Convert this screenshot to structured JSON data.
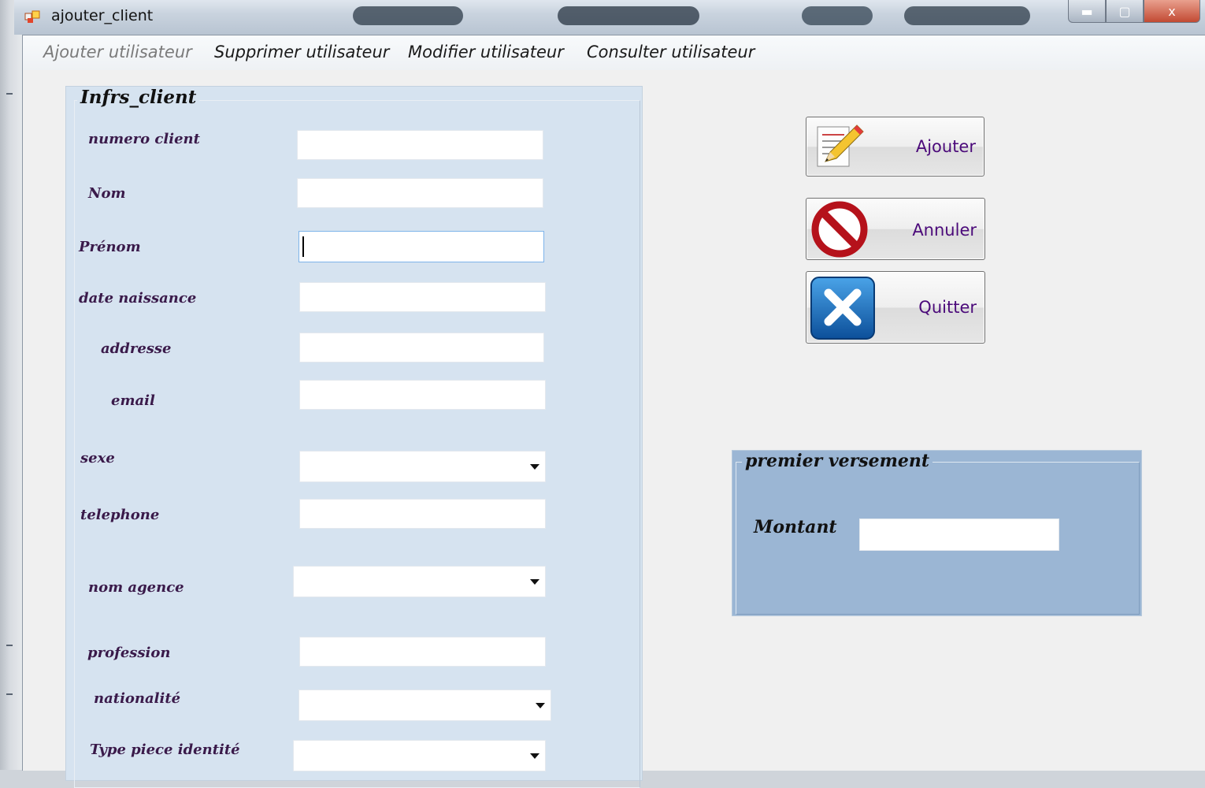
{
  "window": {
    "title": "ajouter_client",
    "controls": [
      "minimize-icon",
      "maximize-icon",
      "close-icon"
    ],
    "control_glyphs": {
      "minimize": "▬",
      "maximize": "▢",
      "close": "x"
    }
  },
  "menu": {
    "items": [
      {
        "label": "Ajouter utilisateur",
        "state": "disabled"
      },
      {
        "label": "Supprimer utilisateur",
        "state": "enabled"
      },
      {
        "label": "Modifier utilisateur",
        "state": "enabled"
      },
      {
        "label": "Consulter utilisateur",
        "state": "enabled"
      }
    ]
  },
  "form": {
    "group_title": "Infrs_client",
    "fields": {
      "numero_client": {
        "label": "numero client",
        "value": ""
      },
      "nom": {
        "label": "Nom",
        "value": ""
      },
      "prenom": {
        "label": "Prénom",
        "value": "",
        "focused": true
      },
      "date_naissance": {
        "label": "date naissance",
        "value": ""
      },
      "addresse": {
        "label": "addresse",
        "value": ""
      },
      "email": {
        "label": "email",
        "value": ""
      },
      "sexe": {
        "label": "sexe",
        "selected": ""
      },
      "telephone": {
        "label": "telephone",
        "value": ""
      },
      "nom_agence": {
        "label": "nom agence",
        "selected": ""
      },
      "profession": {
        "label": "profession",
        "value": ""
      },
      "nationalite": {
        "label": "nationalité",
        "selected": ""
      },
      "type_piece": {
        "label": "Type piece identité",
        "selected": ""
      }
    }
  },
  "actions": {
    "ajouter": {
      "label": "Ajouter",
      "icon": "pencil-document-icon"
    },
    "annuler": {
      "label": "Annuler",
      "icon": "no-entry-icon"
    },
    "quitter": {
      "label": "Quitter",
      "icon": "close-x-icon"
    }
  },
  "versement": {
    "group_title": "premier versement",
    "montant_label": "Montant",
    "montant_value": ""
  },
  "colors": {
    "group_client_bg": "#d6e3f0",
    "group_versement_bg": "#9bb6d4",
    "label_color": "#3a1a4a",
    "button_text": "#4b0a7a",
    "window_bg": "#f0f0f0"
  }
}
